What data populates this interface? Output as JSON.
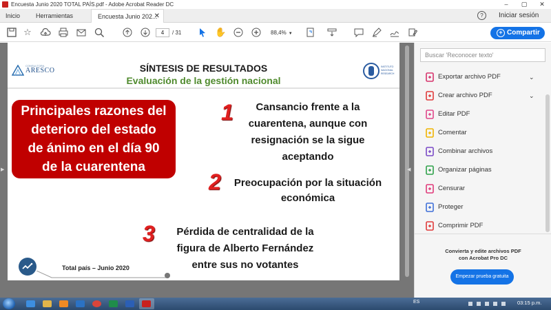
{
  "window": {
    "title": "Encuesta Junio 2020 TOTAL PAÍS.pdf - Adobe Acrobat Reader DC"
  },
  "tabs": {
    "home": "Inicio",
    "tools": "Herramientas",
    "document": "Encuesta Junio 202..."
  },
  "header": {
    "sign_in": "Iniciar sesión"
  },
  "toolbar": {
    "page_current": "4",
    "page_total": "/ 31",
    "zoom": "88,4%",
    "share_label": "Compartir"
  },
  "slide": {
    "title": "SÍNTESIS DE RESULTADOS",
    "subtitle": "Evaluación de la gestión nacional",
    "logo_left_small": "CONSULTORA",
    "logo_left_name": "ARESCO",
    "logo_right_text": "INSTITUTO NACIONAL RESEARCH",
    "box_lines": [
      "Principales razones del",
      "deterioro del estado",
      "de ánimo en el día 90",
      "de la cuarentena"
    ],
    "reasons": [
      {
        "number": "1",
        "lines": [
          "Cansancio frente a la",
          "cuarentena, aunque con",
          "resignación se la sigue",
          "aceptando"
        ]
      },
      {
        "number": "2",
        "lines": [
          "Preocupación por la situación",
          "económica"
        ]
      },
      {
        "number": "3",
        "lines": [
          "Pérdida de centralidad de la",
          "figura de Alberto Fernández",
          "entre sus no votantes"
        ]
      }
    ],
    "footer": "Total país – Junio 2020"
  },
  "right_pane": {
    "search_placeholder": "Buscar 'Reconocer texto'",
    "tools": [
      {
        "label": "Exportar archivo PDF",
        "icon": "export-pdf-icon",
        "color": "#d6336c",
        "expandable": true
      },
      {
        "label": "Crear archivo PDF",
        "icon": "create-pdf-icon",
        "color": "#e03a3a",
        "expandable": true
      },
      {
        "label": "Editar PDF",
        "icon": "edit-pdf-icon",
        "color": "#e0468a",
        "expandable": false
      },
      {
        "label": "Comentar",
        "icon": "comment-icon",
        "color": "#f0b400",
        "expandable": false
      },
      {
        "label": "Combinar archivos",
        "icon": "combine-files-icon",
        "color": "#7b4bc7",
        "expandable": false
      },
      {
        "label": "Organizar páginas",
        "icon": "organize-pages-icon",
        "color": "#2fa24a",
        "expandable": false
      },
      {
        "label": "Censurar",
        "icon": "redact-icon",
        "color": "#e03a7a",
        "expandable": false
      },
      {
        "label": "Proteger",
        "icon": "protect-shield-icon",
        "color": "#3e6fd8",
        "expandable": false
      },
      {
        "label": "Comprimir PDF",
        "icon": "compress-pdf-icon",
        "color": "#e03a3a",
        "expandable": false
      }
    ],
    "promo_text": [
      "Convierta y edite archivos PDF",
      "con Acrobat Pro DC"
    ],
    "trial_button": "Empezar prueba gratuita"
  },
  "taskbar": {
    "language": "ES",
    "clock": "03:15 p.m."
  },
  "colors": {
    "accent": "#1473e6",
    "slide_red": "#c00000",
    "slide_green": "#4f8a2d",
    "number_red": "#e02020"
  }
}
